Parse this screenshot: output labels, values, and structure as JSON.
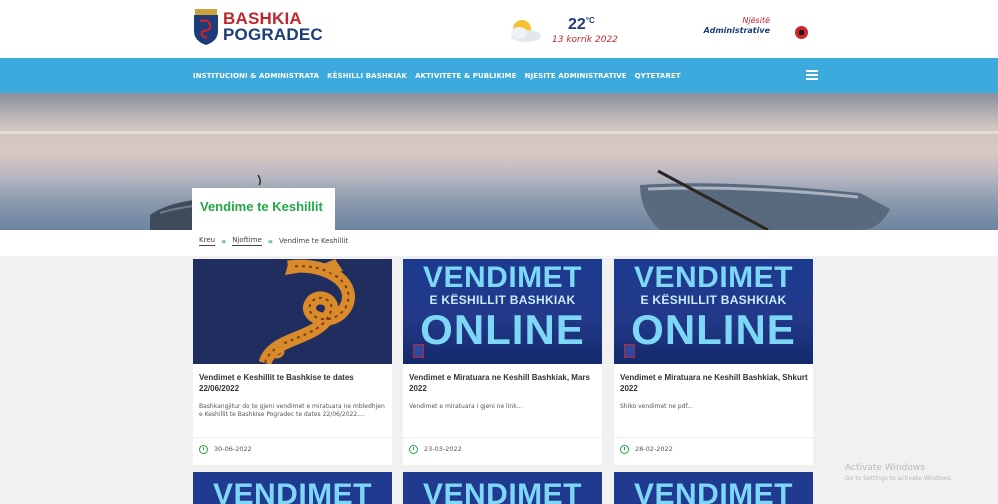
{
  "header": {
    "logo_line1": "BASHKIA",
    "logo_line2": "POGRADEC",
    "weather_temp": "22",
    "weather_unit": "°C",
    "weather_date": "13 korrik 2022",
    "units_line1": "Njësitë",
    "units_line2": "Administrative",
    "language_flag": "albania-flag-icon"
  },
  "nav": {
    "items": [
      "INSTITUCIONI & ADMINISTRATA",
      "KËSHILLI BASHKIAK",
      "AKTIVITETE & PUBLIKIME",
      "NJESITE ADMINISTRATIVE",
      "QYTETARET"
    ],
    "menu_icon": "hamburger-menu-icon"
  },
  "page": {
    "title": "Vendime te Keshillit"
  },
  "breadcrumb": {
    "items": [
      "Kreu",
      "Njoftime",
      "Vendime te Keshillit"
    ],
    "separator": "»"
  },
  "cards": [
    {
      "title": "Vendimet e Keshillit te Bashkise te dates 22/06/2022",
      "description": "Bashkangjitur do te gjeni vendimet e miratuara ne mbledhjen e Keshillit te Bashkise Pogradec te dates 22/06/2022....",
      "date": "30-06-2022",
      "image": "dragon-emblem"
    },
    {
      "title": "Vendimet e Miratuara ne Keshill Bashkiak, Mars 2022",
      "description": "Vendimet e miratuara i gjeni ne link...",
      "date": "23-03-2022",
      "image": "vendimet-online"
    },
    {
      "title": "Vendimet e Miratuara ne Keshill Bashkiak, Shkurt 2022",
      "description": "Shiko vendimet ne pdf...",
      "date": "28-02-2022",
      "image": "vendimet-online"
    }
  ],
  "poster": {
    "line1": "VENDIMET",
    "line2": "E KËSHILLIT BASHKIAK",
    "line3": "ONLINE"
  },
  "bottom_row": [
    "VENDIMET",
    "VENDIMET",
    "VENDIMET"
  ],
  "watermark": {
    "line1": "Activate Windows",
    "line2": "Go to Settings to activate Windows."
  },
  "colors": {
    "nav_bg": "#3caadc",
    "accent_green": "#22a845",
    "brand_red": "#c0272d",
    "brand_blue": "#1d3c78"
  }
}
